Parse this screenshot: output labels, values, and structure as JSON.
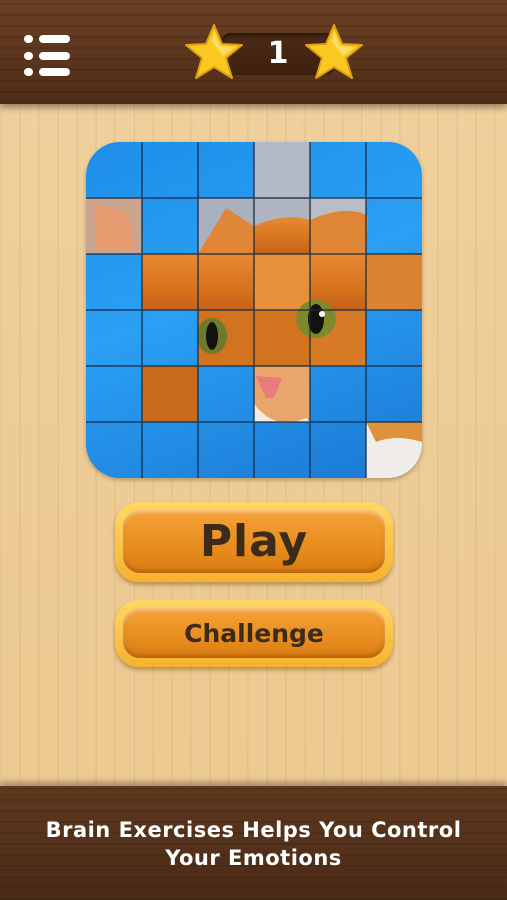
{
  "header": {
    "menu_icon": "menu-list-icon",
    "level": "1",
    "star_icon": "star-icon",
    "star_color": "#f7c51e"
  },
  "puzzle": {
    "image": "orange-cat-photo",
    "tile_bg_color": "#2196f3",
    "grid_rows": 6,
    "grid_cols": 6
  },
  "buttons": {
    "play_label": "Play",
    "challenge_label": "Challenge",
    "accent": "#f0982a"
  },
  "footer": {
    "tip_line1": "Brain Exercises Helps You Control",
    "tip_line2": "Your Emotions"
  }
}
